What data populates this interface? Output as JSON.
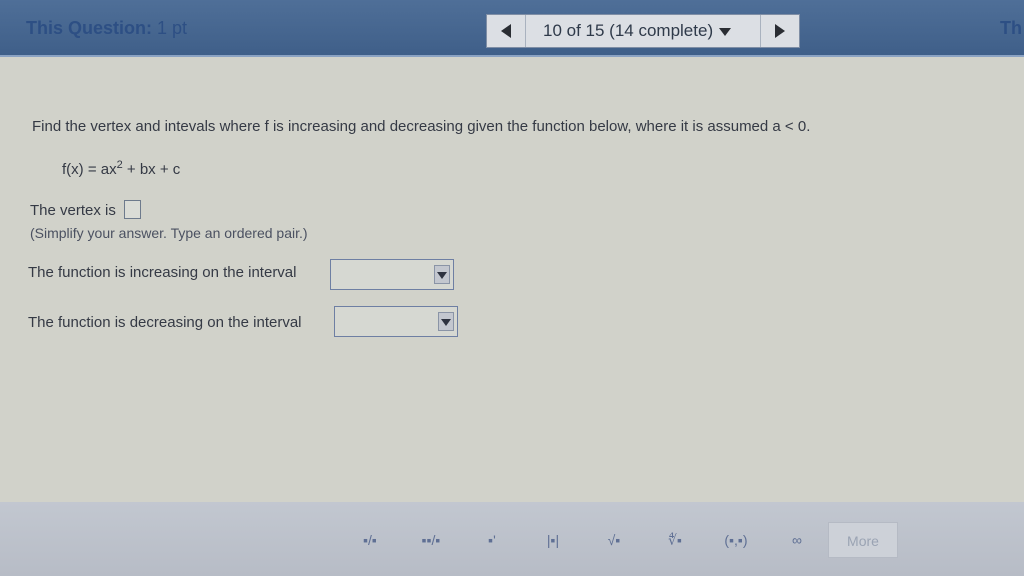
{
  "header": {
    "question_label": "This Question:",
    "points": "1 pt",
    "progress": "10 of 15 (14 complete)",
    "right_clip_text": "Th"
  },
  "question": {
    "prompt": "Find the vertex and intevals where f is increasing and decreasing given the function below, where it is assumed a < 0.",
    "function_base": "f(x) = ax",
    "function_exp": "2",
    "function_rest": " + bx + c",
    "vertex_label": "The vertex is",
    "vertex_hint": "(Simplify your answer. Type an ordered pair.)",
    "increasing_label": "The function is increasing on the interval",
    "decreasing_label": "The function is decreasing on the interval"
  },
  "toolbar": {
    "tools": [
      {
        "name": "fraction-tool",
        "glyph": "▪/▪"
      },
      {
        "name": "mixed-number-tool",
        "glyph": "▪▪/▪"
      },
      {
        "name": "exponent-tool",
        "glyph": "▪'"
      },
      {
        "name": "absolute-value-tool",
        "glyph": "|▪|"
      },
      {
        "name": "square-root-tool",
        "glyph": "√▪"
      },
      {
        "name": "nth-root-tool",
        "glyph": "∜▪"
      },
      {
        "name": "ordered-pair-tool",
        "glyph": "(▪,▪)"
      },
      {
        "name": "infinity-tool",
        "glyph": "∞"
      }
    ],
    "more_label": "More"
  }
}
